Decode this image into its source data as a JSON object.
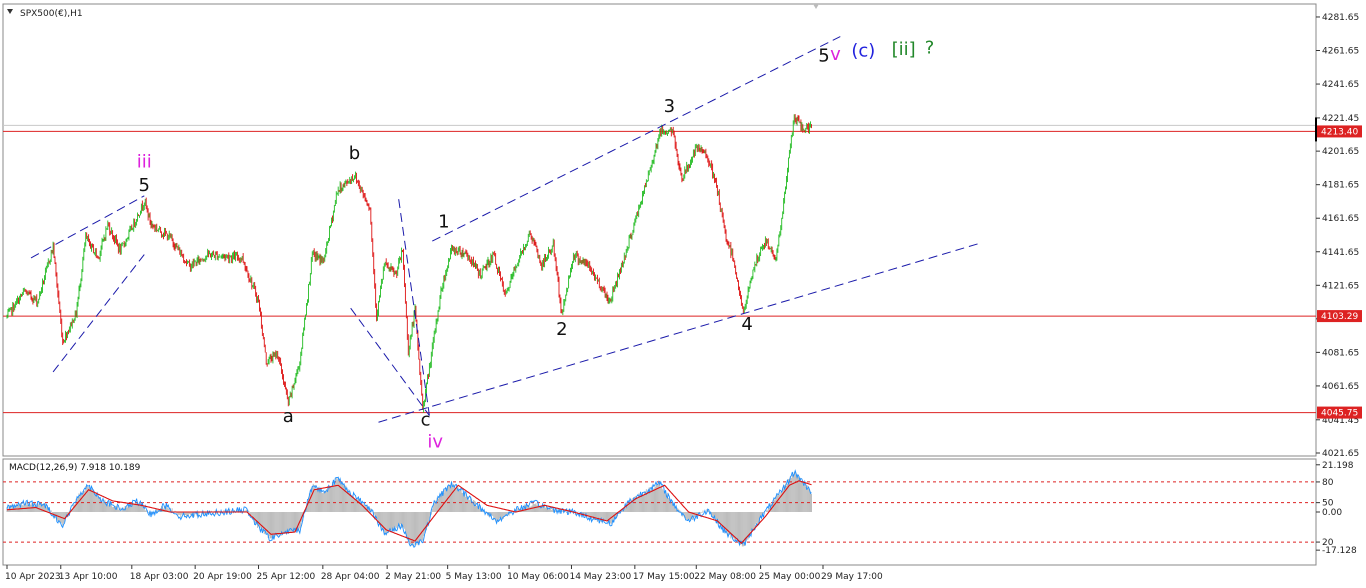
{
  "header": {
    "symbol_label": "SPX500(€),H1",
    "macd_label": "MACD(12,26,9) 7.918 10.189"
  },
  "chart_data": {
    "type": "candlestick",
    "symbol": "SPX500(€)",
    "timeframe": "H1",
    "price_ylim": [
      4021.65,
      4287
    ],
    "price_ticks": [
      "4281.65",
      "4261.65",
      "4241.65",
      "4221.45",
      "4201.65",
      "4181.65",
      "4161.65",
      "4141.65",
      "4121.65",
      "4101.65",
      "4081.65",
      "4061.65",
      "4041.45",
      "4021.65"
    ],
    "price_tick_values": [
      4281.65,
      4261.65,
      4241.65,
      4221.45,
      4201.65,
      4181.65,
      4161.65,
      4141.65,
      4121.65,
      4101.65,
      4081.65,
      4061.65,
      4041.45,
      4021.65
    ],
    "x_ticks": [
      "10 Apr 2023",
      "13 Apr 10:00",
      "18 Apr 03:00",
      "20 Apr 19:00",
      "25 Apr 12:00",
      "28 Apr 04:00",
      "2 May 21:00",
      "5 May 13:00",
      "10 May 06:00",
      "14 May 23:00",
      "17 May 15:00",
      "22 May 08:00",
      "25 May 00:00",
      "29 May 17:00"
    ],
    "x_tick_index": [
      0,
      56,
      130,
      196,
      262,
      329,
      396,
      459,
      523,
      588,
      654,
      718,
      785,
      850
    ],
    "bar_count": 860,
    "last_bar_index": 838,
    "path": [
      [
        0,
        4103
      ],
      [
        18,
        4118
      ],
      [
        32,
        4112
      ],
      [
        48,
        4145
      ],
      [
        58,
        4088
      ],
      [
        72,
        4105
      ],
      [
        82,
        4150
      ],
      [
        95,
        4138
      ],
      [
        105,
        4158
      ],
      [
        118,
        4142
      ],
      [
        132,
        4158
      ],
      [
        143,
        4172
      ],
      [
        150,
        4158
      ],
      [
        170,
        4150
      ],
      [
        190,
        4133
      ],
      [
        210,
        4140
      ],
      [
        245,
        4138
      ],
      [
        262,
        4112
      ],
      [
        270,
        4076
      ],
      [
        282,
        4081
      ],
      [
        293,
        4051
      ],
      [
        305,
        4076
      ],
      [
        318,
        4140
      ],
      [
        330,
        4136
      ],
      [
        344,
        4178
      ],
      [
        362,
        4187
      ],
      [
        378,
        4168
      ],
      [
        385,
        4103
      ],
      [
        393,
        4134
      ],
      [
        405,
        4128
      ],
      [
        412,
        4142
      ],
      [
        418,
        4082
      ],
      [
        425,
        4107
      ],
      [
        433,
        4048
      ],
      [
        441,
        4076
      ],
      [
        452,
        4118
      ],
      [
        463,
        4143
      ],
      [
        478,
        4141
      ],
      [
        493,
        4128
      ],
      [
        507,
        4140
      ],
      [
        519,
        4115
      ],
      [
        530,
        4133
      ],
      [
        545,
        4153
      ],
      [
        557,
        4133
      ],
      [
        569,
        4146
      ],
      [
        578,
        4104
      ],
      [
        590,
        4140
      ],
      [
        606,
        4133
      ],
      [
        628,
        4112
      ],
      [
        646,
        4144
      ],
      [
        656,
        4163
      ],
      [
        668,
        4187
      ],
      [
        680,
        4213
      ],
      [
        693,
        4214
      ],
      [
        703,
        4185
      ],
      [
        718,
        4203
      ],
      [
        729,
        4200
      ],
      [
        740,
        4178
      ],
      [
        748,
        4152
      ],
      [
        757,
        4137
      ],
      [
        767,
        4104
      ],
      [
        777,
        4131
      ],
      [
        790,
        4148
      ],
      [
        801,
        4138
      ],
      [
        808,
        4165
      ],
      [
        814,
        4196
      ],
      [
        820,
        4222
      ],
      [
        829,
        4215
      ],
      [
        838,
        4216
      ]
    ],
    "horizontal_levels": [
      {
        "label": "4213.40",
        "value": 4213.4,
        "color": "#dd2222"
      },
      {
        "label": "4103.29",
        "value": 4103.29,
        "color": "#dd2222"
      },
      {
        "label": "4045.75",
        "value": 4045.75,
        "color": "#dd2222"
      }
    ],
    "trendlines": [
      {
        "x1": 25,
        "y1": 4138,
        "x2": 143,
        "y2": 4175
      },
      {
        "x1": 48,
        "y1": 4070,
        "x2": 143,
        "y2": 4140
      },
      {
        "x1": 358,
        "y1": 4108,
        "x2": 440,
        "y2": 4044
      },
      {
        "x1": 408,
        "y1": 4173,
        "x2": 440,
        "y2": 4044
      },
      {
        "x1": 443,
        "y1": 4148,
        "x2": 868,
        "y2": 4270
      },
      {
        "x1": 387,
        "y1": 4040,
        "x2": 1015,
        "y2": 4147
      }
    ],
    "wave_labels": [
      {
        "text": "iii",
        "index": 143,
        "price": 4192,
        "color": "#dd22dd"
      },
      {
        "text": "5",
        "index": 143,
        "price": 4178,
        "color": "#111111"
      },
      {
        "text": "a",
        "index": 293,
        "price": 4040,
        "color": "#111111"
      },
      {
        "text": "b",
        "index": 362,
        "price": 4197,
        "color": "#111111"
      },
      {
        "text": "c",
        "index": 436,
        "price": 4038,
        "color": "#111111"
      },
      {
        "text": "iv",
        "index": 446,
        "price": 4025,
        "color": "#dd22dd"
      },
      {
        "text": "1",
        "index": 455,
        "price": 4156,
        "color": "#111111"
      },
      {
        "text": "2",
        "index": 578,
        "price": 4092,
        "color": "#111111"
      },
      {
        "text": "3",
        "index": 690,
        "price": 4225,
        "color": "#111111"
      },
      {
        "text": "4",
        "index": 771,
        "price": 4095,
        "color": "#111111"
      },
      {
        "text": "5",
        "index": 851,
        "price": 4255,
        "color": "#111111"
      },
      {
        "text": "v",
        "index": 863,
        "price": 4256,
        "color": "#dd22dd"
      },
      {
        "text": "(c)",
        "index": 892,
        "price": 4258,
        "color": "#2222dd"
      },
      {
        "text": "[ii]",
        "index": 934,
        "price": 4259,
        "color": "#22882a"
      },
      {
        "text": "?",
        "index": 961,
        "price": 4260,
        "color": "#22882a"
      }
    ],
    "current_price": {
      "label": "4213.40",
      "value": 4213.4
    },
    "macd": {
      "name": "MACD(12,26,9)",
      "main_value": 7.918,
      "signal_value": 10.189,
      "ylim": [
        -22,
        22
      ],
      "tick_labels": [
        "21.198",
        "80",
        "50",
        "0.00",
        "20",
        "-17.128"
      ],
      "tick_values": [
        21.198,
        13.5,
        4.2,
        0.0,
        -13.5,
        -17.128
      ],
      "levels": [
        13.5,
        4.2,
        -13.5
      ],
      "path": [
        [
          0,
          2
        ],
        [
          20,
          4
        ],
        [
          40,
          3
        ],
        [
          58,
          -6
        ],
        [
          75,
          8
        ],
        [
          85,
          12
        ],
        [
          100,
          5
        ],
        [
          120,
          1
        ],
        [
          135,
          5
        ],
        [
          150,
          -1
        ],
        [
          165,
          3
        ],
        [
          180,
          -2
        ],
        [
          200,
          -1
        ],
        [
          225,
          0
        ],
        [
          250,
          1
        ],
        [
          262,
          -7
        ],
        [
          275,
          -12
        ],
        [
          290,
          -9
        ],
        [
          305,
          -8
        ],
        [
          318,
          12
        ],
        [
          330,
          9
        ],
        [
          344,
          15
        ],
        [
          362,
          7
        ],
        [
          380,
          1
        ],
        [
          393,
          -10
        ],
        [
          412,
          -6
        ],
        [
          420,
          -15
        ],
        [
          433,
          -13
        ],
        [
          445,
          4
        ],
        [
          463,
          13
        ],
        [
          480,
          7
        ],
        [
          495,
          1
        ],
        [
          510,
          -4
        ],
        [
          530,
          1
        ],
        [
          550,
          4
        ],
        [
          570,
          1
        ],
        [
          590,
          0
        ],
        [
          610,
          -3
        ],
        [
          630,
          -5
        ],
        [
          646,
          4
        ],
        [
          660,
          8
        ],
        [
          680,
          13
        ],
        [
          695,
          3
        ],
        [
          710,
          -4
        ],
        [
          730,
          1
        ],
        [
          748,
          -9
        ],
        [
          767,
          -15
        ],
        [
          780,
          -6
        ],
        [
          795,
          3
        ],
        [
          808,
          10
        ],
        [
          820,
          18
        ],
        [
          830,
          13
        ],
        [
          840,
          8
        ]
      ],
      "signal_path": [
        [
          0,
          1
        ],
        [
          30,
          2
        ],
        [
          60,
          -3
        ],
        [
          85,
          10
        ],
        [
          110,
          5
        ],
        [
          140,
          3
        ],
        [
          170,
          0
        ],
        [
          210,
          0
        ],
        [
          250,
          0
        ],
        [
          275,
          -10
        ],
        [
          300,
          -9
        ],
        [
          320,
          10
        ],
        [
          345,
          12
        ],
        [
          370,
          3
        ],
        [
          395,
          -8
        ],
        [
          425,
          -13
        ],
        [
          450,
          1
        ],
        [
          470,
          12
        ],
        [
          500,
          3
        ],
        [
          530,
          0
        ],
        [
          560,
          3
        ],
        [
          590,
          0
        ],
        [
          625,
          -4
        ],
        [
          655,
          6
        ],
        [
          685,
          12
        ],
        [
          710,
          0
        ],
        [
          740,
          -4
        ],
        [
          765,
          -14
        ],
        [
          790,
          -2
        ],
        [
          815,
          12
        ],
        [
          825,
          14
        ],
        [
          840,
          12
        ]
      ]
    },
    "colors": {
      "up": "#22bb22",
      "down": "#dd1111",
      "level": "#dd2222",
      "trend": "#1a1aaa",
      "histogram": "#bdbdbd",
      "macd_line": "#1e90ff",
      "signal_line": "#dd1111"
    }
  }
}
